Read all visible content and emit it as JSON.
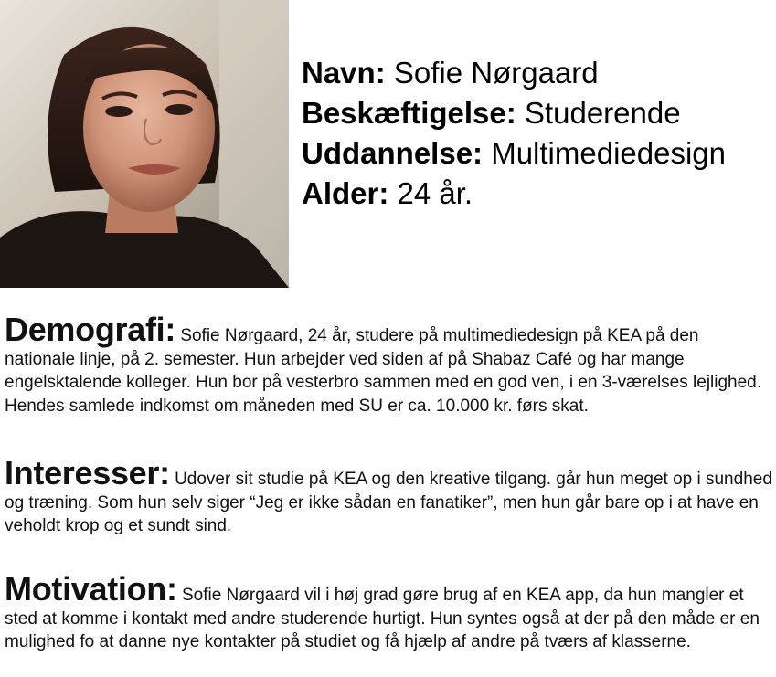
{
  "profile": {
    "name_label": "Navn:",
    "name_value": "Sofie Nørgaard",
    "job_label": "Beskæftigelse:",
    "job_value": "Studerende",
    "edu_label": "Uddannelse:",
    "edu_value": "Multimediedesign",
    "age_label": "Alder:",
    "age_value": "24 år."
  },
  "sections": {
    "demografi": {
      "heading": "Demografi:",
      "text": "Sofie Nørgaard, 24 år, studere på multimediedesign på KEA på den nationale linje, på 2. semester. Hun arbejder ved siden af på Shabaz Café og har mange engelsktalende kolleger. Hun bor på vesterbro sammen med en god ven, i en 3-værelses lejlighed. Hendes samlede indkomst om måneden med SU er ca. 10.000 kr. førs skat."
    },
    "interesser": {
      "heading": "Interesser:",
      "text": "Udover sit studie på KEA og den kreative tilgang. går hun meget op i sundhed og træning. Som hun selv siger “Jeg er ikke sådan en fanatiker”, men hun går bare op i at have en veholdt krop og et sundt sind."
    },
    "motivation": {
      "heading": "Motivation:",
      "text": "Sofie Nørgaard vil i høj grad gøre brug af en KEA app, da hun mangler et sted at komme i kontakt med andre studerende hurtigt. Hun syntes også at der på den måde er en mulighed fo at danne nye kontakter på studiet og få hjælp af andre på tværs af klasserne."
    }
  }
}
